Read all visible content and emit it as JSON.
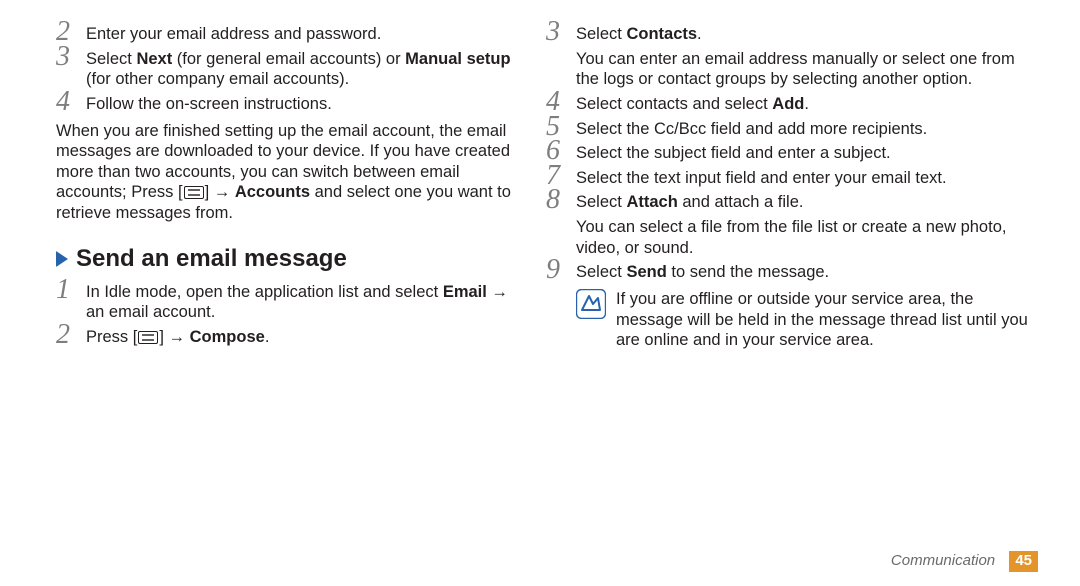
{
  "left": {
    "steps_a": [
      {
        "n": "2",
        "html": "Enter your email address and password."
      },
      {
        "n": "3",
        "html": "Select <b>Next</b> (for general email accounts) or <b>Manual setup</b> (for other company email accounts)."
      },
      {
        "n": "4",
        "html": "Follow the on-screen instructions."
      }
    ],
    "para": "When you are finished setting up the email account, the email messages are downloaded to your device. If you have created more than two accounts, you can switch between email accounts; Press [{MENU}] → <b>Accounts</b> and select one you want to retrieve messages from.",
    "heading": "Send an email message",
    "steps_b": [
      {
        "n": "1",
        "html": "In Idle mode, open the application list and select <b>Email</b> → an email account."
      },
      {
        "n": "2",
        "html": "Press [{MENU}] → <b>Compose</b>."
      }
    ]
  },
  "right": {
    "steps": [
      {
        "n": "3",
        "html": "Select <b>Contacts</b>.",
        "sub": "You can enter an email address manually or select one from the logs or contact groups by selecting another option."
      },
      {
        "n": "4",
        "html": "Select contacts and select <b>Add</b>."
      },
      {
        "n": "5",
        "html": "Select the Cc/Bcc field and add more recipients."
      },
      {
        "n": "6",
        "html": "Select the subject field and enter a subject."
      },
      {
        "n": "7",
        "html": "Select the text input field and enter your email text."
      },
      {
        "n": "8",
        "html": "Select <b>Attach</b> and attach a file.",
        "sub": "You can select a file from the file list or create a new photo, video, or sound."
      },
      {
        "n": "9",
        "html": "Select <b>Send</b> to send the message."
      }
    ],
    "note": "If you are offline or outside your service area, the message will be held in the message thread list until you are online and in your service area."
  },
  "footer": {
    "chapter": "Communication",
    "page": "45"
  }
}
